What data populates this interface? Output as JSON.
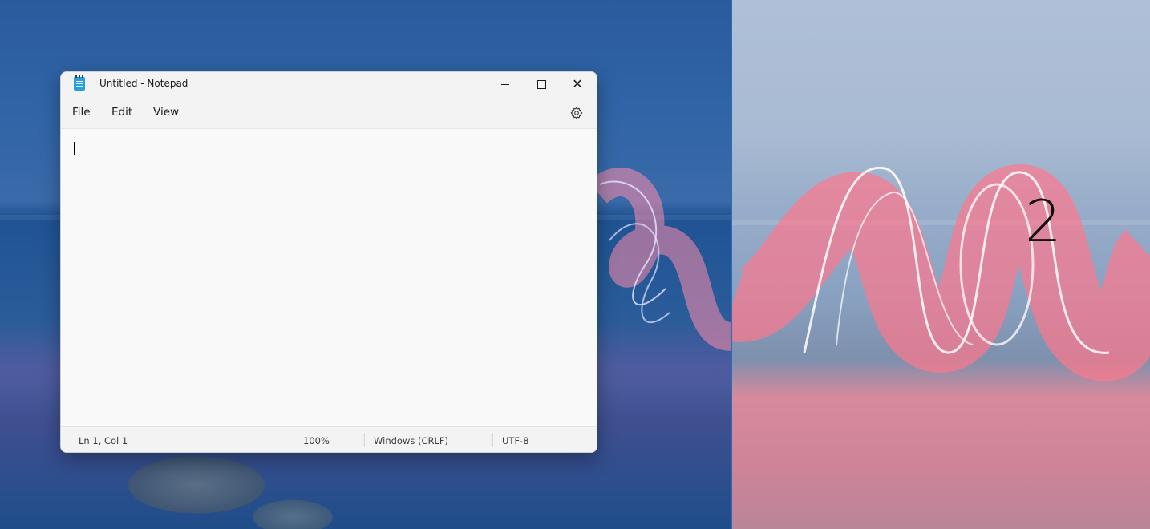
{
  "notepad": {
    "title": "Untitled - Notepad",
    "menu": [
      "File",
      "Edit",
      "View"
    ],
    "icons": {
      "app": "notepad-icon",
      "minimize": "minimize-icon",
      "maximize": "maximize-icon",
      "close": "close-icon",
      "settings": "gear-icon"
    },
    "close_glyph": "✕",
    "editor_text": "",
    "status": {
      "position": "Ln 1, Col 1",
      "zoom": "100%",
      "line_ending": "Windows (CRLF)",
      "encoding": "UTF-8"
    }
  },
  "display_identifier": "2",
  "colors": {
    "accent": "#2a6bbd",
    "window_bg": "#f9f9f9",
    "chrome_bg": "#f3f3f3"
  }
}
